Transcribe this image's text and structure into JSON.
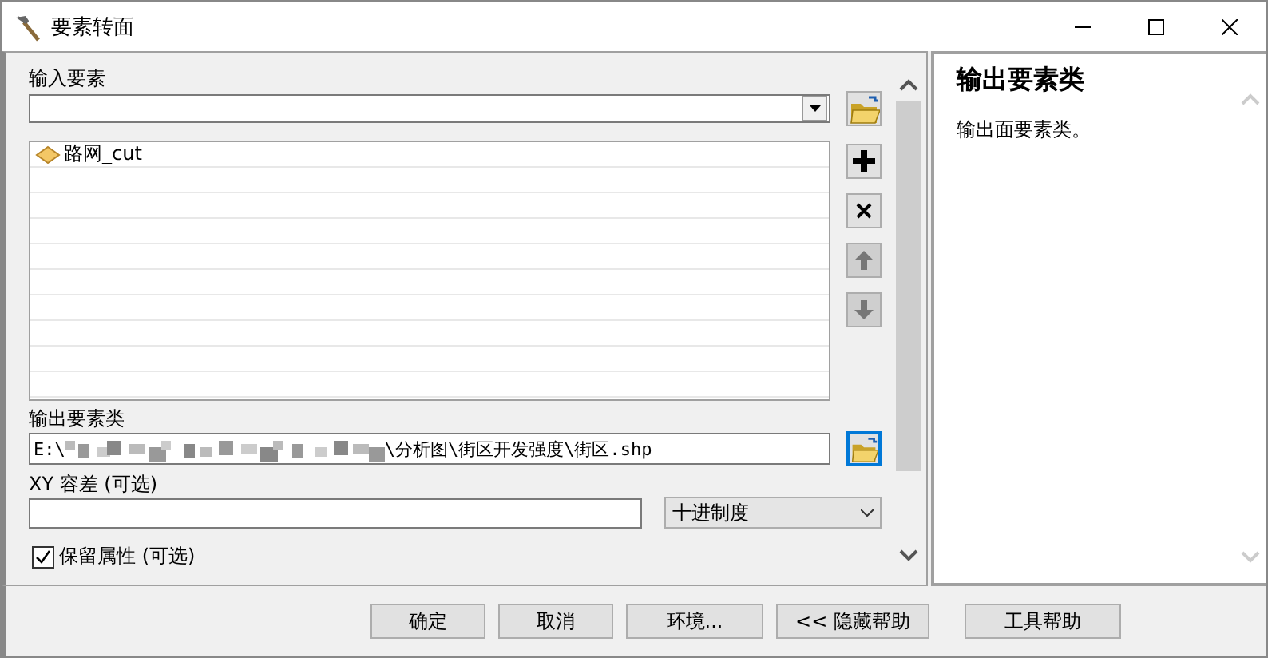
{
  "window": {
    "title": "要素转面"
  },
  "form": {
    "input_features": {
      "label": "输入要素",
      "browse_focused": false
    },
    "input_list": {
      "items": [
        {
          "label": "路网_cut",
          "kind": "polygon"
        }
      ],
      "tools": [
        {
          "kind": "add",
          "disabled": false
        },
        {
          "kind": "remove",
          "disabled": false
        },
        {
          "kind": "up",
          "disabled": true
        },
        {
          "kind": "down",
          "disabled": true
        }
      ]
    },
    "output_class": {
      "label": "输出要素类",
      "prefix": "E:\\",
      "suffix": "\\分析图\\街区开发强度\\街区.shp",
      "redacted": true,
      "browse_focused": true
    },
    "xy_tolerance": {
      "label": "XY 容差 (可选)",
      "unit": "十进制度"
    },
    "keep_attributes": {
      "label": "保留属性 (可选)",
      "checked": true
    }
  },
  "help": {
    "title": "输出要素类",
    "text": "输出面要素类。"
  },
  "buttons": [
    {
      "label": "确定"
    },
    {
      "label": "取消"
    },
    {
      "label": "环境..."
    },
    {
      "label": "<< 隐藏帮助"
    },
    {
      "label": "工具帮助"
    }
  ]
}
